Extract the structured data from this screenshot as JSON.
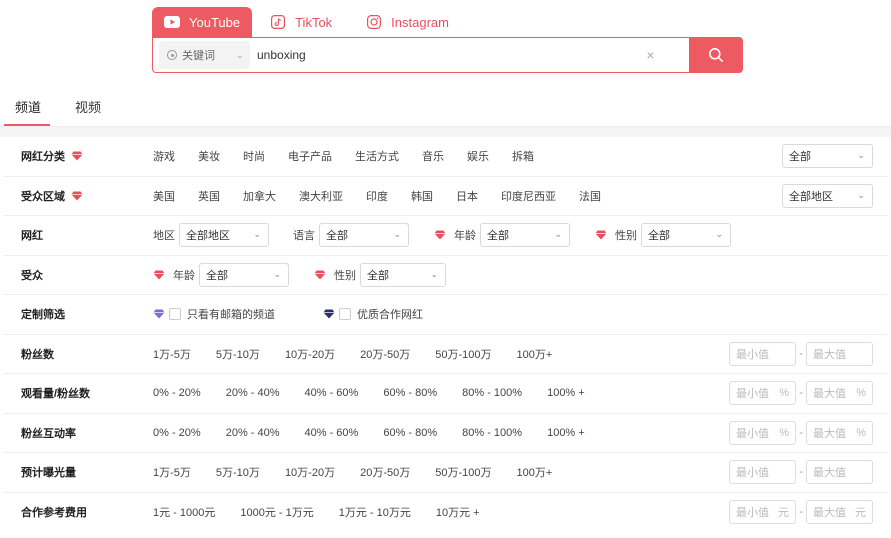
{
  "platform_tabs": [
    {
      "label": "YouTube",
      "icon": "youtube-icon",
      "active": true
    },
    {
      "label": "TikTok",
      "icon": "tiktok-icon",
      "active": false
    },
    {
      "label": "Instagram",
      "icon": "instagram-icon",
      "active": false
    }
  ],
  "search": {
    "field_type": "关键词",
    "value": "unboxing"
  },
  "content_tabs": [
    {
      "label": "频道",
      "active": true
    },
    {
      "label": "视频",
      "active": false
    }
  ],
  "filters": {
    "category": {
      "label": "网红分类",
      "options": [
        "游戏",
        "美妆",
        "时尚",
        "电子产品",
        "生活方式",
        "音乐",
        "娱乐",
        "拆箱"
      ],
      "select": "全部"
    },
    "audience_region": {
      "label": "受众区域",
      "options": [
        "美国",
        "英国",
        "加拿大",
        "澳大利亚",
        "印度",
        "韩国",
        "日本",
        "印度尼西亚",
        "法国"
      ],
      "select": "全部地区"
    },
    "influencer": {
      "label": "网红",
      "region_label": "地区",
      "region_value": "全部地区",
      "language_label": "语言",
      "language_value": "全部",
      "age_label": "年龄",
      "age_value": "全部",
      "gender_label": "性别",
      "gender_value": "全部"
    },
    "audience": {
      "label": "受众",
      "age_label": "年龄",
      "age_value": "全部",
      "gender_label": "性别",
      "gender_value": "全部"
    },
    "custom": {
      "label": "定制筛选",
      "email_only": "只看有邮箱的频道",
      "quality": "优质合作网红"
    },
    "followers": {
      "label": "粉丝数",
      "options": [
        "1万-5万",
        "5万-10万",
        "10万-20万",
        "20万-50万",
        "50万-100万",
        "100万+"
      ],
      "min": "最小值",
      "max": "最大值",
      "unit": ""
    },
    "view_ratio": {
      "label": "观看量/粉丝数",
      "options": [
        "0% - 20%",
        "20% - 40%",
        "40% - 60%",
        "60% - 80%",
        "80% - 100%",
        "100% +"
      ],
      "min": "最小值",
      "max": "最大值",
      "unit": "%"
    },
    "engagement": {
      "label": "粉丝互动率",
      "options": [
        "0% - 20%",
        "20% - 40%",
        "40% - 60%",
        "60% - 80%",
        "80% - 100%",
        "100% +"
      ],
      "min": "最小值",
      "max": "最大值",
      "unit": "%"
    },
    "exposure": {
      "label": "预计曝光量",
      "options": [
        "1万-5万",
        "5万-10万",
        "10万-20万",
        "20万-50万",
        "50万-100万",
        "100万+"
      ],
      "min": "最小值",
      "max": "最大值",
      "unit": ""
    },
    "cost": {
      "label": "合作参考费用",
      "options": [
        "1元 - 1000元",
        "1000元 - 1万元",
        "1万元 - 10万元",
        "10万元 +"
      ],
      "min": "最小值",
      "max": "最大值",
      "unit": "元"
    }
  },
  "colors": {
    "accent": "#ee5a62",
    "gem_red": "#e8505b",
    "gem_purple": "#7b6fd6",
    "gem_navy": "#2c2f6b"
  }
}
